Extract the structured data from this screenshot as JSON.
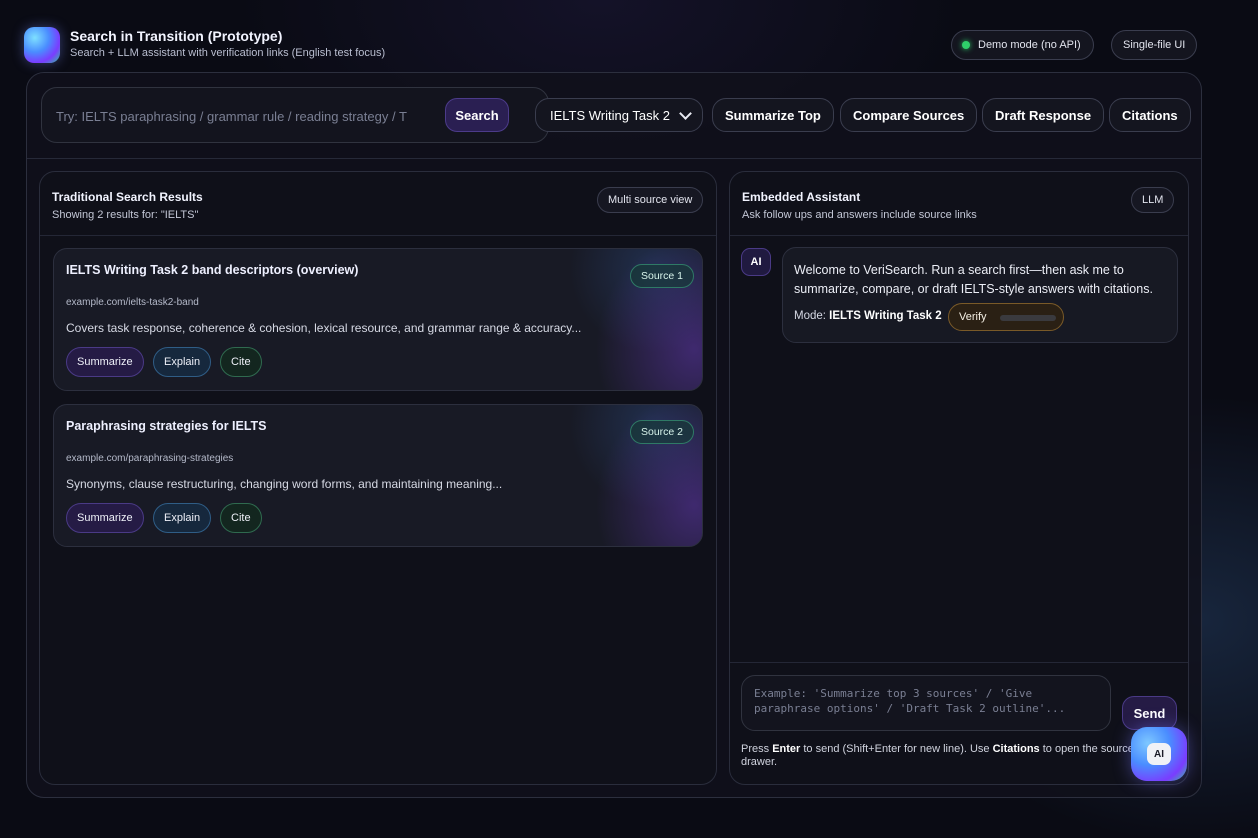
{
  "header": {
    "title": "Search in Transition (Prototype)",
    "subtitle": "Search + LLM assistant with verification links (English test focus)",
    "status_pill": "Demo mode (no API)",
    "layout_pill": "Single-file UI",
    "status_color": "#2fd06a"
  },
  "toolbar": {
    "search_placeholder": "Try: IELTS paraphrasing / grammar rule / reading strategy / T",
    "search_value": "",
    "search_button": "Search",
    "mode_selected": "IELTS Writing Task 2",
    "summarize_top": "Summarize Top",
    "compare_sources": "Compare Sources",
    "draft_response": "Draft Response",
    "citations": "Citations"
  },
  "results": {
    "title": "Traditional Search Results",
    "subtitle": "Showing 2 results for: \"IELTS\"",
    "view_pill": "Multi source view",
    "items": [
      {
        "title": "IELTS Writing Task 2 band descriptors (overview)",
        "url": "example.com/ielts-task2-band",
        "snippet": "Covers task response, coherence & cohesion, lexical resource, and grammar range & accuracy...",
        "badge": "Source 1",
        "actions": {
          "summarize": "Summarize",
          "explain": "Explain",
          "cite": "Cite"
        }
      },
      {
        "title": "Paraphrasing strategies for IELTS",
        "url": "example.com/paraphrasing-strategies",
        "snippet": "Synonyms, clause restructuring, changing word forms, and maintaining meaning...",
        "badge": "Source 2",
        "actions": {
          "summarize": "Summarize",
          "explain": "Explain",
          "cite": "Cite"
        }
      }
    ]
  },
  "assistant": {
    "title": "Embedded Assistant",
    "subtitle": "Ask follow ups and answers include source links",
    "model_pill": "LLM",
    "avatar_label": "AI",
    "welcome": "Welcome to VeriSearch. Run a search first—then ask me to summarize, compare, or draft IELTS-style answers with citations.",
    "mode_label": "Mode:",
    "mode_value": "IELTS Writing Task 2",
    "verify_label": "Verify",
    "input_placeholder": "Example: 'Summarize top 3 sources' / 'Give paraphrase options' / 'Draft Task 2 outline'...",
    "send_button": "Send",
    "hint_1": "Press ",
    "hint_enter": "Enter",
    "hint_2": " to send (Shift+Enter for new line). Use ",
    "hint_citations": "Citations",
    "hint_3": " to open the source drawer."
  },
  "fab": {
    "label": "AI"
  }
}
